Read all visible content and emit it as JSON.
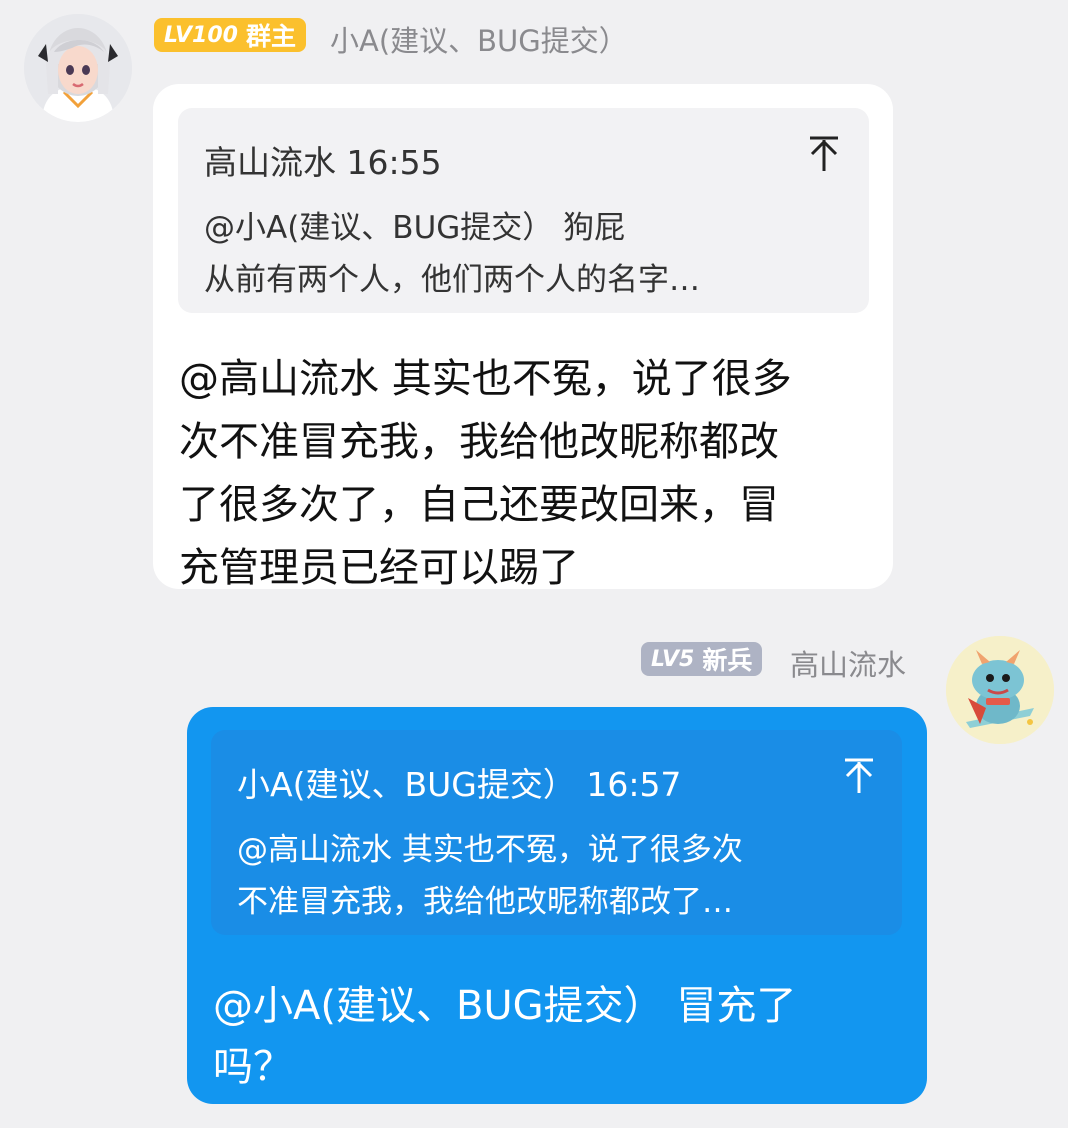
{
  "messages": [
    {
      "sender": {
        "level_label": "LV100",
        "role_label": "群主",
        "name": "小A(建议、BUG提交）",
        "avatar_icon": "female-avatar-icon"
      },
      "quote": {
        "author": "高山流水",
        "time": "16:55",
        "line1": "@小A(建议、BUG提交） 狗屁",
        "line2": "从前有两个人，他们两个人的名字…",
        "jump_icon": "jump-to-top-icon"
      },
      "text_lines": [
        "@高山流水 其实也不冤，说了很多",
        "次不准冒充我，我给他改昵称都改",
        "了很多次了，自己还要改回来，冒",
        "充管理员已经可以踢了"
      ]
    },
    {
      "sender": {
        "level_label": "LV5",
        "role_label": "新兵",
        "name": "高山流水",
        "avatar_icon": "dragon-avatar-icon"
      },
      "quote": {
        "author": "小A(建议、BUG提交）",
        "time": "16:57",
        "line1": "@高山流水 其实也不冤，说了很多次",
        "line2": "不准冒充我，我给他改昵称都改了…",
        "jump_icon": "jump-to-top-icon"
      },
      "text_lines": [
        "@小A(建议、BUG提交） 冒充了",
        "吗？"
      ]
    }
  ],
  "colors": {
    "background": "#f0f0f2",
    "incoming_bubble": "#ffffff",
    "outgoing_bubble": "#1296f0",
    "owner_badge": "#fbc02d",
    "recruit_badge": "#aeb3c4",
    "name_text": "#8a8a8e"
  }
}
